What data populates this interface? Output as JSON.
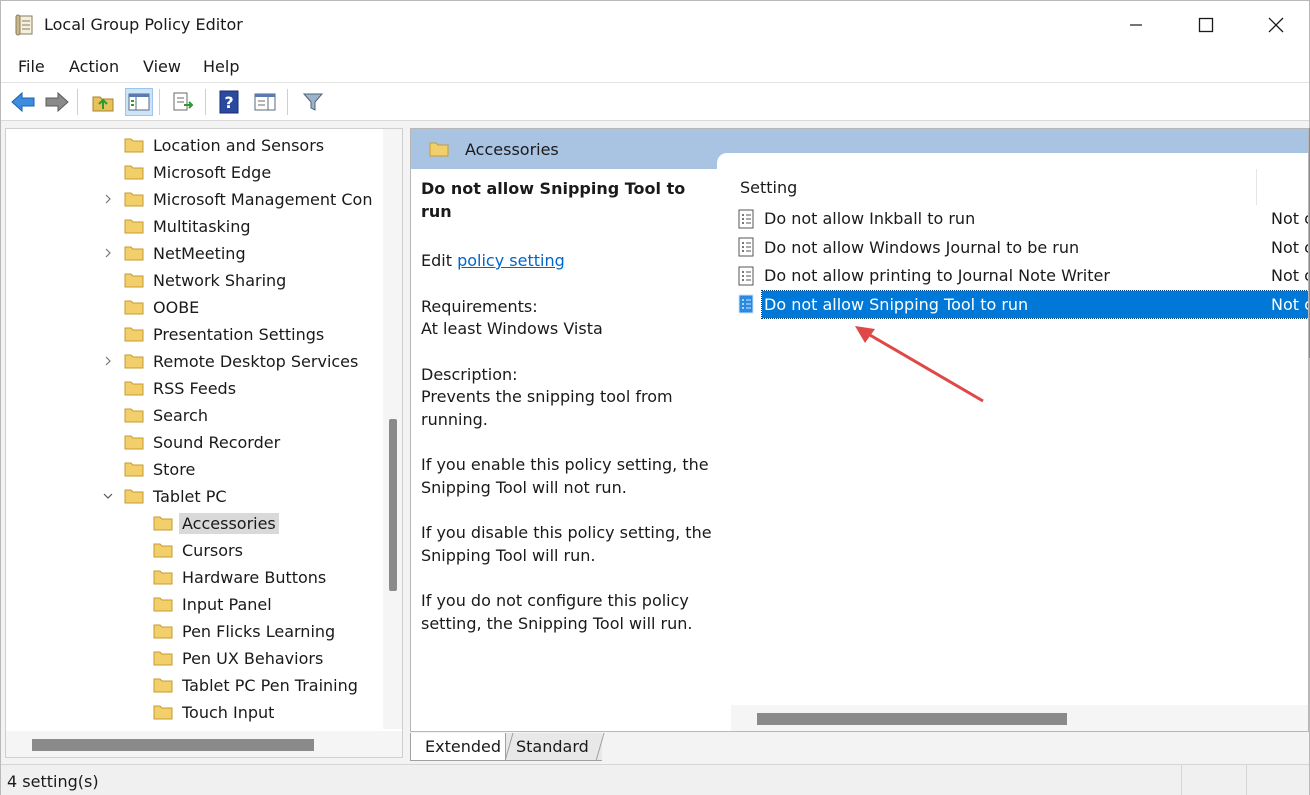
{
  "window": {
    "title": "Local Group Policy Editor"
  },
  "menu": [
    {
      "id": "file",
      "label": "File"
    },
    {
      "id": "action",
      "label": "Action"
    },
    {
      "id": "view",
      "label": "View"
    },
    {
      "id": "help",
      "label": "Help"
    }
  ],
  "tree": {
    "items": [
      {
        "label": "Location and Sensors",
        "level": 1,
        "expandable": false
      },
      {
        "label": "Microsoft Edge",
        "level": 1,
        "expandable": false
      },
      {
        "label": "Microsoft Management Con",
        "level": 1,
        "expandable": true
      },
      {
        "label": "Multitasking",
        "level": 1,
        "expandable": false
      },
      {
        "label": "NetMeeting",
        "level": 1,
        "expandable": true
      },
      {
        "label": "Network Sharing",
        "level": 1,
        "expandable": false
      },
      {
        "label": "OOBE",
        "level": 1,
        "expandable": false
      },
      {
        "label": "Presentation Settings",
        "level": 1,
        "expandable": false
      },
      {
        "label": "Remote Desktop Services",
        "level": 1,
        "expandable": true
      },
      {
        "label": "RSS Feeds",
        "level": 1,
        "expandable": false
      },
      {
        "label": "Search",
        "level": 1,
        "expandable": false
      },
      {
        "label": "Sound Recorder",
        "level": 1,
        "expandable": false
      },
      {
        "label": "Store",
        "level": 1,
        "expandable": false
      },
      {
        "label": "Tablet PC",
        "level": 1,
        "expandable": true,
        "expanded": true
      },
      {
        "label": "Accessories",
        "level": 2,
        "selected": true
      },
      {
        "label": "Cursors",
        "level": 2
      },
      {
        "label": "Hardware Buttons",
        "level": 2
      },
      {
        "label": "Input Panel",
        "level": 2
      },
      {
        "label": "Pen Flicks Learning",
        "level": 2
      },
      {
        "label": "Pen UX Behaviors",
        "level": 2
      },
      {
        "label": "Tablet PC Pen Training",
        "level": 2
      },
      {
        "label": "Touch Input",
        "level": 2
      }
    ]
  },
  "details": {
    "header": "Accessories",
    "policy_title": "Do not allow Snipping Tool to run",
    "edit_prefix": "Edit",
    "edit_link": "policy setting",
    "requirements_label": "Requirements:",
    "requirements_value": "At least Windows Vista",
    "description_label": "Description:",
    "description_text": "Prevents the snipping tool from running.",
    "enable_text": "If you enable this policy setting, the Snipping Tool will not run.",
    "disable_text": "If you disable this policy setting, the Snipping Tool will run.",
    "notconfig_text": "If you do not configure this policy setting, the Snipping Tool will run."
  },
  "list": {
    "column_setting": "Setting",
    "rows": [
      {
        "name": "Do not allow Inkball to run",
        "state": "Not c"
      },
      {
        "name": "Do not allow Windows Journal to be run",
        "state": "Not c"
      },
      {
        "name": "Do not allow printing to Journal Note Writer",
        "state": "Not c"
      },
      {
        "name": "Do not allow Snipping Tool to run",
        "state": "Not c",
        "selected": true
      }
    ]
  },
  "tabs": {
    "extended": "Extended",
    "standard": "Standard"
  },
  "status": {
    "text": "4 setting(s)"
  },
  "colors": {
    "selection": "#0078d7",
    "header_band": "#a9c4e3",
    "link": "#0066cc",
    "annotation_arrow": "#e04848"
  }
}
